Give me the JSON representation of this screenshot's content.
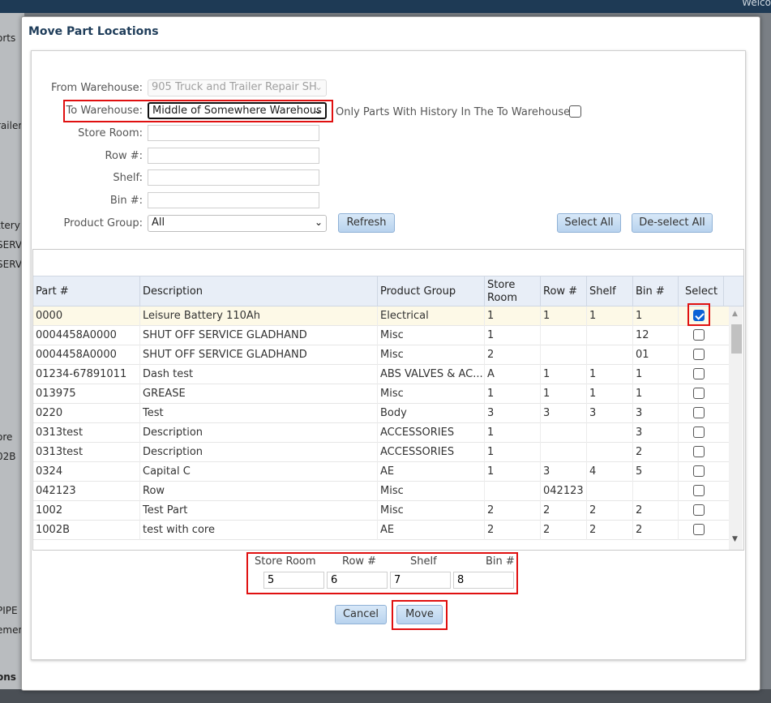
{
  "background": {
    "welcome_text": "Welco",
    "left_fragments": [
      "orts",
      "railer",
      "ttery",
      "SERV",
      "SERV",
      "ore",
      "02B",
      "PIPE",
      "emen",
      "ons"
    ]
  },
  "dialog": {
    "title": "Move Part Locations"
  },
  "form": {
    "from_warehouse_label": "From Warehouse:",
    "from_warehouse_value": "905 Truck and Trailer Repair SH",
    "to_warehouse_label": "To Warehouse:",
    "to_warehouse_value": "Middle of Somewhere Warehous",
    "only_history_label": "Only Parts With History In The To Warehouse:",
    "only_history_checked": false,
    "store_room_label": "Store Room:",
    "store_room_value": "",
    "row_label": "Row #:",
    "row_value": "",
    "shelf_label": "Shelf:",
    "shelf_value": "",
    "bin_label": "Bin #:",
    "bin_value": "",
    "product_group_label": "Product Group:",
    "product_group_value": "All",
    "refresh_label": "Refresh",
    "select_all_label": "Select All",
    "deselect_all_label": "De-select All"
  },
  "table": {
    "headers": [
      "Part #",
      "Description",
      "Product Group",
      "Store Room",
      "Row #",
      "Shelf",
      "Bin #",
      "Select"
    ],
    "rows": [
      {
        "part": "0000",
        "desc": "Leisure Battery 110Ah",
        "group": "Electrical",
        "store": "1",
        "row": "1",
        "shelf": "1",
        "bin": "1",
        "selected": true
      },
      {
        "part": "0004458A0000",
        "desc": "SHUT OFF SERVICE GLADHAND",
        "group": "Misc",
        "store": "1",
        "row": "",
        "shelf": "",
        "bin": "12",
        "selected": false
      },
      {
        "part": "0004458A0000",
        "desc": "SHUT OFF SERVICE GLADHAND",
        "group": "Misc",
        "store": "2",
        "row": "",
        "shelf": "",
        "bin": "01",
        "selected": false
      },
      {
        "part": "01234-67891011",
        "desc": "Dash test",
        "group": "ABS VALVES & AC...",
        "store": "A",
        "row": "1",
        "shelf": "1",
        "bin": "1",
        "selected": false
      },
      {
        "part": "013975",
        "desc": "GREASE",
        "group": "Misc",
        "store": "1",
        "row": "1",
        "shelf": "1",
        "bin": "1",
        "selected": false
      },
      {
        "part": "0220",
        "desc": "Test",
        "group": "Body",
        "store": "3",
        "row": "3",
        "shelf": "3",
        "bin": "3",
        "selected": false
      },
      {
        "part": "0313test",
        "desc": "Description",
        "group": "ACCESSORIES",
        "store": "1",
        "row": "",
        "shelf": "",
        "bin": "3",
        "selected": false
      },
      {
        "part": "0313test",
        "desc": "Description",
        "group": "ACCESSORIES",
        "store": "1",
        "row": "",
        "shelf": "",
        "bin": "2",
        "selected": false
      },
      {
        "part": "0324",
        "desc": "Capital C",
        "group": "AE",
        "store": "1",
        "row": "3",
        "shelf": "4",
        "bin": "5",
        "selected": false
      },
      {
        "part": "042123",
        "desc": "Row",
        "group": "Misc",
        "store": "",
        "row": "042123",
        "shelf": "",
        "bin": "",
        "selected": false
      },
      {
        "part": "1002",
        "desc": "Test Part",
        "group": "Misc",
        "store": "2",
        "row": "2",
        "shelf": "2",
        "bin": "2",
        "selected": false
      },
      {
        "part": "1002B",
        "desc": "test with core",
        "group": "AE",
        "store": "2",
        "row": "2",
        "shelf": "2",
        "bin": "2",
        "selected": false
      }
    ]
  },
  "target_location": {
    "store_room_label": "Store Room",
    "row_label": "Row #",
    "shelf_label": "Shelf",
    "bin_label": "Bin #",
    "store_room_value": "5",
    "row_value": "6",
    "shelf_value": "7",
    "bin_value": "8"
  },
  "actions": {
    "cancel_label": "Cancel",
    "move_label": "Move"
  },
  "colors": {
    "highlight": "#e01010",
    "button_border": "#8fb1d6",
    "title": "#1f3d5a",
    "header_bg": "#e8eef7"
  }
}
